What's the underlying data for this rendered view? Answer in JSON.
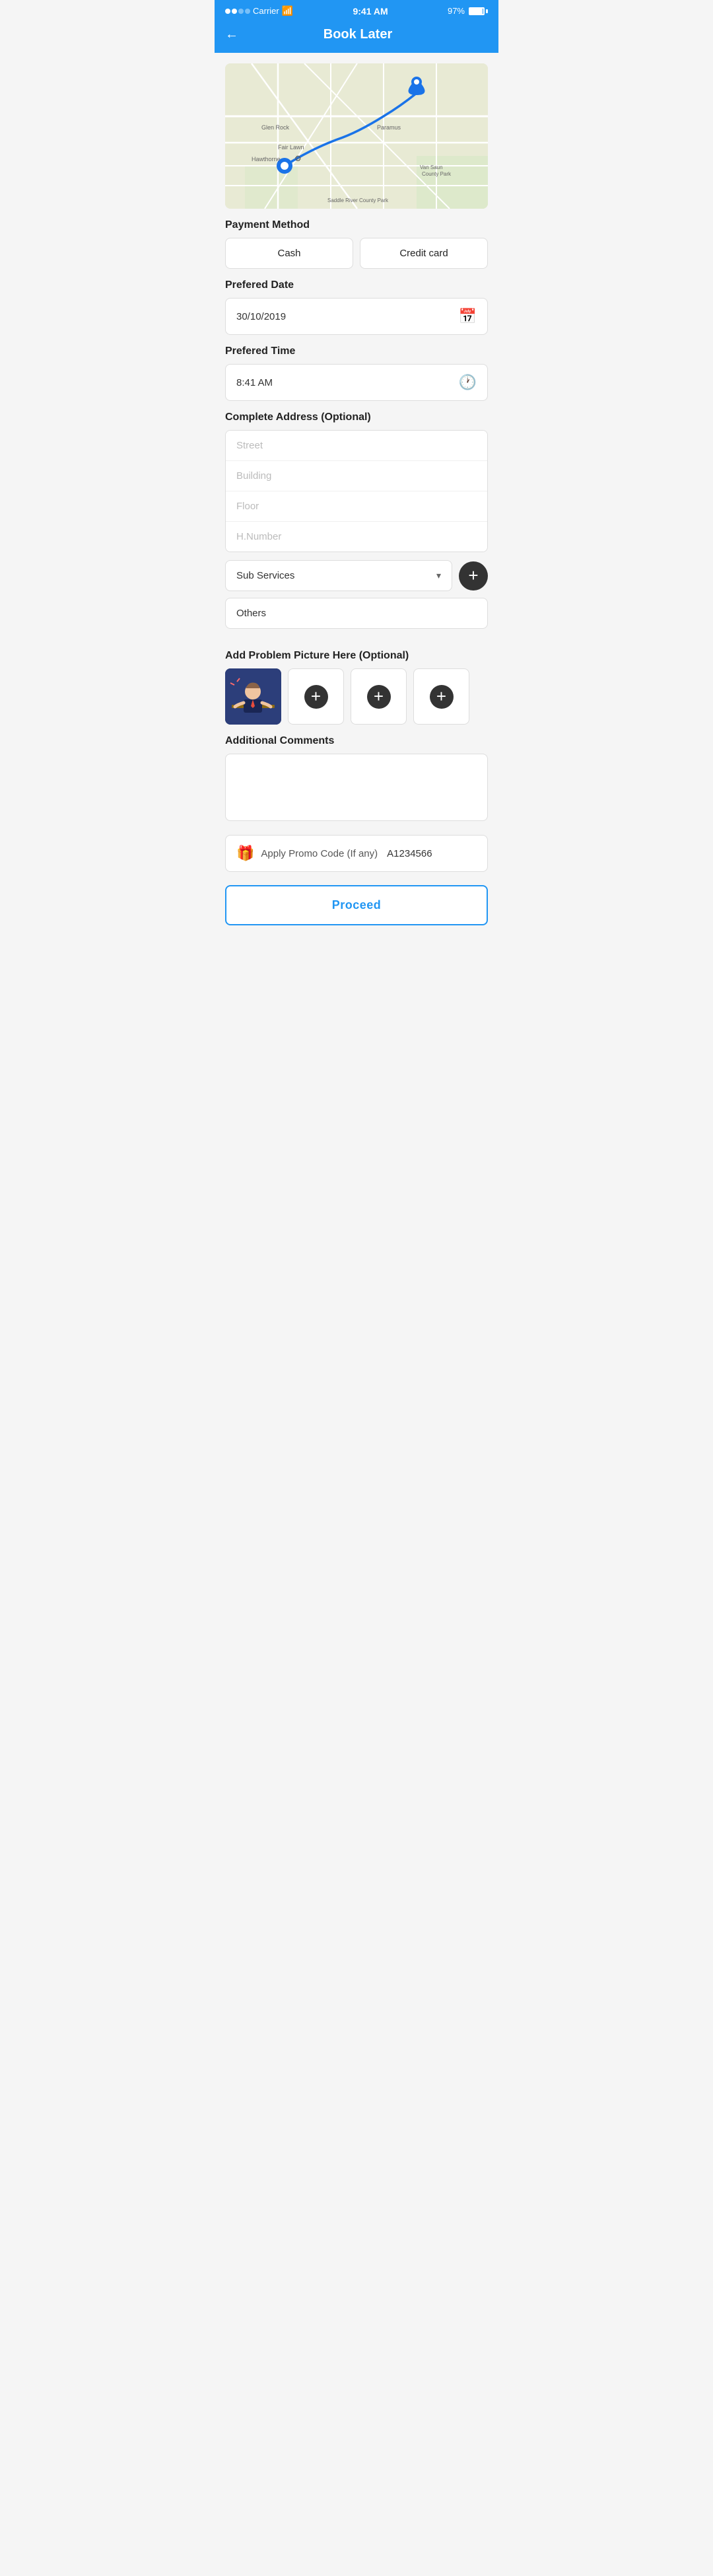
{
  "statusBar": {
    "carrier": "Carrier",
    "time": "9:41 AM",
    "battery": "97%"
  },
  "header": {
    "title": "Book Later",
    "backLabel": "←"
  },
  "map": {
    "locations": [
      "Glen Rock",
      "Fair Lawn",
      "Paramus",
      "Hawthorne",
      "Saddle River County Park",
      "Van Saun County Park"
    ],
    "pin1Label": "Origin",
    "pin2Label": "Destination"
  },
  "paymentMethod": {
    "label": "Payment Method",
    "options": [
      "Cash",
      "Credit card"
    ]
  },
  "preferredDate": {
    "label": "Prefered Date",
    "value": "30/10/2019"
  },
  "preferredTime": {
    "label": "Prefered Time",
    "value": "8:41 AM"
  },
  "address": {
    "label": "Complete Address (Optional)",
    "fields": {
      "street": {
        "placeholder": "Street",
        "value": ""
      },
      "building": {
        "placeholder": "Building",
        "value": ""
      },
      "floor": {
        "placeholder": "Floor",
        "value": ""
      },
      "hNumber": {
        "placeholder": "H.Number",
        "value": ""
      }
    }
  },
  "subServices": {
    "label": "Sub Services",
    "placeholder": "Sub Services",
    "addBtn": "+"
  },
  "others": {
    "value": "Others"
  },
  "addPicture": {
    "label": "Add Problem Picture Here (Optional)",
    "addBtnLabel": "+"
  },
  "additionalComments": {
    "label": "Additional Comments",
    "placeholder": ""
  },
  "promoCode": {
    "label": "Apply Promo Code (If any)",
    "value": "A1234566"
  },
  "proceed": {
    "label": "Proceed"
  }
}
